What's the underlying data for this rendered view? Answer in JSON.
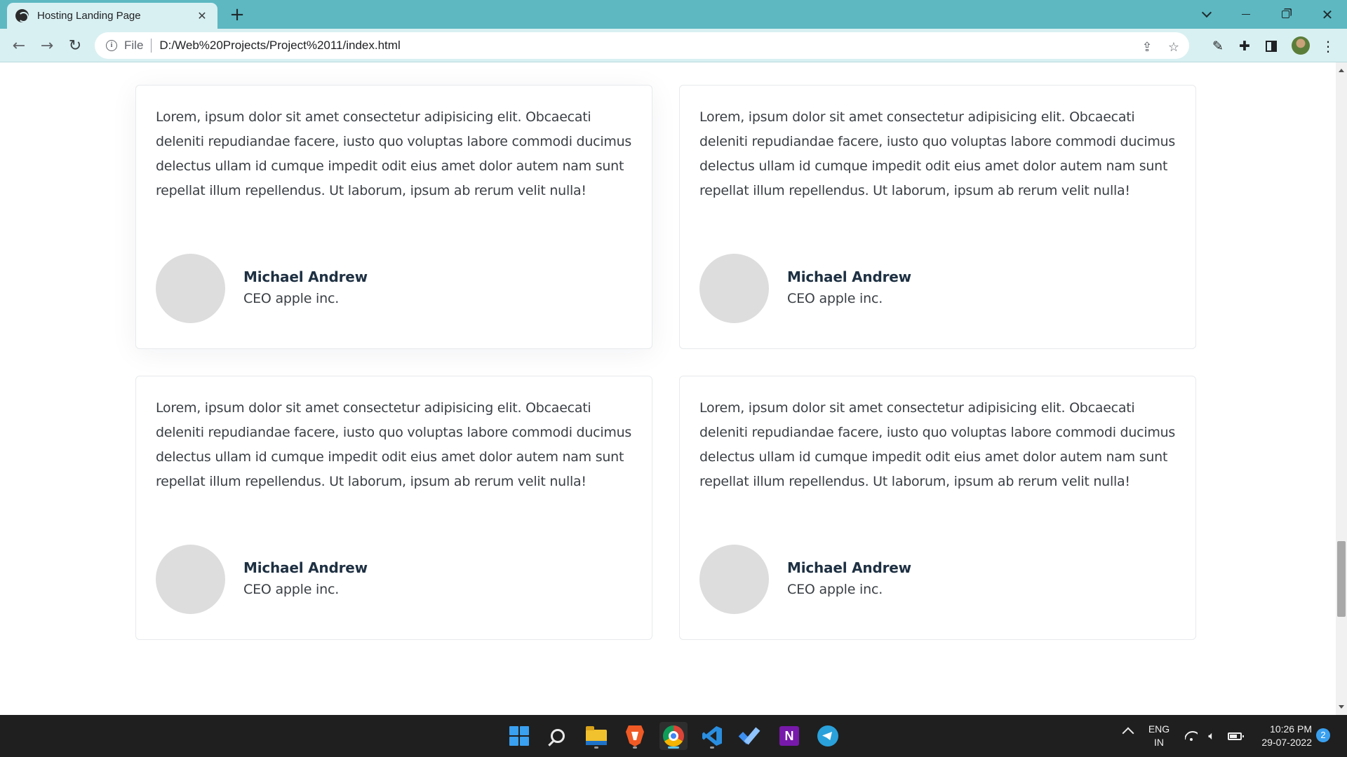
{
  "browser": {
    "tab_title": "Hosting Landing Page",
    "tab_close": "✕",
    "new_tab": "+",
    "url_scheme": "File",
    "url": "D:/Web%20Projects/Project%2011/index.html"
  },
  "testimonials": [
    {
      "quote": "Lorem, ipsum dolor sit amet consectetur adipisicing elit. Obcaecati deleniti repudiandae facere, iusto quo voluptas labore commodi ducimus delectus ullam id cumque impedit odit eius amet dolor autem nam sunt repellat illum repellendus. Ut laborum, ipsum ab rerum velit nulla!",
      "name": "Michael Andrew",
      "role": "CEO apple inc."
    },
    {
      "quote": "Lorem, ipsum dolor sit amet consectetur adipisicing elit. Obcaecati deleniti repudiandae facere, iusto quo voluptas labore commodi ducimus delectus ullam id cumque impedit odit eius amet dolor autem nam sunt repellat illum repellendus. Ut laborum, ipsum ab rerum velit nulla!",
      "name": "Michael Andrew",
      "role": "CEO apple inc."
    },
    {
      "quote": "Lorem, ipsum dolor sit amet consectetur adipisicing elit. Obcaecati deleniti repudiandae facere, iusto quo voluptas labore commodi ducimus delectus ullam id cumque impedit odit eius amet dolor autem nam sunt repellat illum repellendus. Ut laborum, ipsum ab rerum velit nulla!",
      "name": "Michael Andrew",
      "role": "CEO apple inc."
    },
    {
      "quote": "Lorem, ipsum dolor sit amet consectetur adipisicing elit. Obcaecati deleniti repudiandae facere, iusto quo voluptas labore commodi ducimus delectus ullam id cumque impedit odit eius amet dolor autem nam sunt repellat illum repellendus. Ut laborum, ipsum ab rerum velit nulla!",
      "name": "Michael Andrew",
      "role": "CEO apple inc."
    }
  ],
  "taskbar": {
    "apps": [
      "windows-start",
      "search",
      "file-explorer",
      "brave",
      "chrome",
      "vscode",
      "microsoft-todo",
      "onenote",
      "telegram"
    ],
    "language": "ENG",
    "region": "IN",
    "time": "10:26 PM",
    "date": "29-07-2022",
    "notifications": "2"
  },
  "colors": {
    "tabstrip": "#5db8c2",
    "toolbar": "#d9f0f2",
    "name_text": "#1e3042",
    "body_text": "#3a3f44",
    "avatar_placeholder": "#dddddd",
    "taskbar": "#1f1f1f"
  }
}
